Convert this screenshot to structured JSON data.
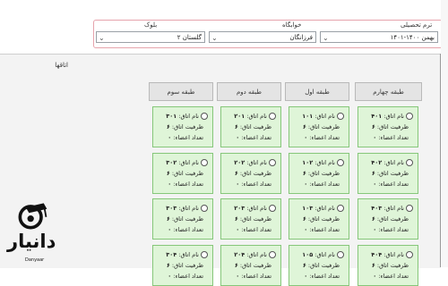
{
  "filters": {
    "term": {
      "label": "ترم تحصیلی",
      "value": "بهمن ۱۴۰۰-۱۴۰۱"
    },
    "dorm": {
      "label": "خوابگاه",
      "value": "فرزانگان"
    },
    "block": {
      "label": "بلوک",
      "value": "گلستان ۲"
    }
  },
  "rooms_title": "اتاقها",
  "floors": [
    "طبقه چهارم",
    "طبقه اول",
    "طبقه دوم",
    "طبقه سوم"
  ],
  "card_labels": {
    "name": "نام اتاق:",
    "capacity": "ظرفیت اتاق:",
    "members": "تعداد اعضاء:"
  },
  "rows": [
    [
      {
        "room": "۴۰۱",
        "capacity": "۶",
        "members": "۰"
      },
      {
        "room": "۱۰۱",
        "capacity": "۶",
        "members": "۰"
      },
      {
        "room": "۲۰۱",
        "capacity": "۶",
        "members": "۰"
      },
      {
        "room": "۳۰۱",
        "capacity": "۶",
        "members": "۰"
      }
    ],
    [
      {
        "room": "۴۰۲",
        "capacity": "۶",
        "members": "۰"
      },
      {
        "room": "۱۰۲",
        "capacity": "۶",
        "members": "۰"
      },
      {
        "room": "۲۰۲",
        "capacity": "۶",
        "members": "۰"
      },
      {
        "room": "۳۰۲",
        "capacity": "۶",
        "members": "۰"
      }
    ],
    [
      {
        "room": "۴۰۳",
        "capacity": "۶",
        "members": "۰"
      },
      {
        "room": "۱۰۳",
        "capacity": "۶",
        "members": "۰"
      },
      {
        "room": "۲۰۳",
        "capacity": "۶",
        "members": "۰"
      },
      {
        "room": "۳۰۳",
        "capacity": "۶",
        "members": "۰"
      }
    ],
    [
      {
        "room": "۴۰۴",
        "capacity": "۶",
        "members": "۰"
      },
      {
        "room": "۱۰۵",
        "capacity": "۶",
        "members": "۰"
      },
      {
        "room": "۲۰۴",
        "capacity": "۶",
        "members": "۰"
      },
      {
        "room": "۳۰۴",
        "capacity": "۶",
        "members": "۰"
      }
    ]
  ],
  "watermark": {
    "name": "دانیار",
    "sub": "Danyaar"
  },
  "colors": {
    "card_bg": "#dff5d8",
    "card_border": "#86c77a",
    "filter_border": "#e6a3ac"
  }
}
